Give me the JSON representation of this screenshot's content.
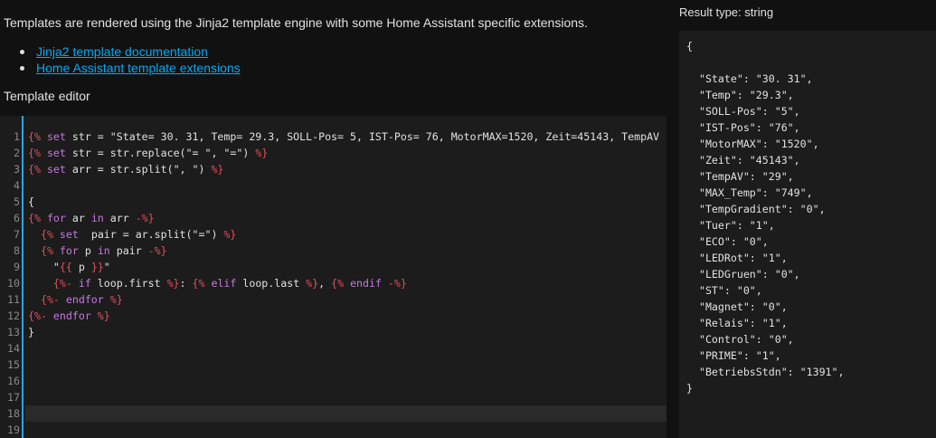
{
  "intro_text": "Templates are rendered using the Jinja2 template engine with some Home Assistant specific extensions.",
  "links": [
    "Jinja2 template documentation",
    "Home Assistant template extensions"
  ],
  "editor_label": "Template editor",
  "editor": {
    "lines": [
      {
        "n": "1",
        "segments": [
          {
            "t": "tag",
            "s": "{% "
          },
          {
            "t": "kw",
            "s": "set"
          },
          {
            "t": "str",
            "s": " str = \"State= 30. 31, Temp= 29.3, SOLL-Pos= 5, IST-Pos= 76, MotorMAX=1520, Zeit=45143, TempAV"
          }
        ]
      },
      {
        "n": "2",
        "segments": [
          {
            "t": "tag",
            "s": "{% "
          },
          {
            "t": "kw",
            "s": "set"
          },
          {
            "t": "str",
            "s": " str = str.replace(\"= \", \"=\") "
          },
          {
            "t": "tag",
            "s": "%}"
          }
        ]
      },
      {
        "n": "3",
        "segments": [
          {
            "t": "tag",
            "s": "{% "
          },
          {
            "t": "kw",
            "s": "set"
          },
          {
            "t": "str",
            "s": " arr = str.split(\", \") "
          },
          {
            "t": "tag",
            "s": "%}"
          }
        ]
      },
      {
        "n": "4",
        "segments": []
      },
      {
        "n": "5",
        "segments": [
          {
            "t": "str",
            "s": "{"
          }
        ]
      },
      {
        "n": "6",
        "segments": [
          {
            "t": "tag",
            "s": "{% "
          },
          {
            "t": "kw",
            "s": "for"
          },
          {
            "t": "str",
            "s": " ar "
          },
          {
            "t": "kw",
            "s": "in"
          },
          {
            "t": "str",
            "s": " arr "
          },
          {
            "t": "tag",
            "s": "-%}"
          }
        ]
      },
      {
        "n": "7",
        "segments": [
          {
            "t": "str",
            "s": "  "
          },
          {
            "t": "tag",
            "s": "{% "
          },
          {
            "t": "kw",
            "s": "set"
          },
          {
            "t": "str",
            "s": "  pair = ar.split(\"=\") "
          },
          {
            "t": "tag",
            "s": "%}"
          }
        ]
      },
      {
        "n": "8",
        "segments": [
          {
            "t": "str",
            "s": "  "
          },
          {
            "t": "tag",
            "s": "{% "
          },
          {
            "t": "kw",
            "s": "for"
          },
          {
            "t": "str",
            "s": " p "
          },
          {
            "t": "kw",
            "s": "in"
          },
          {
            "t": "str",
            "s": " pair "
          },
          {
            "t": "tag",
            "s": "-%}"
          }
        ]
      },
      {
        "n": "9",
        "segments": [
          {
            "t": "str",
            "s": "    \""
          },
          {
            "t": "tag",
            "s": "{{"
          },
          {
            "t": "str",
            "s": " p "
          },
          {
            "t": "tag",
            "s": "}}"
          },
          {
            "t": "str",
            "s": "\""
          }
        ]
      },
      {
        "n": "10",
        "segments": [
          {
            "t": "str",
            "s": "    "
          },
          {
            "t": "tag",
            "s": "{%- "
          },
          {
            "t": "kw",
            "s": "if"
          },
          {
            "t": "str",
            "s": " loop.first "
          },
          {
            "t": "tag",
            "s": "%}"
          },
          {
            "t": "str",
            "s": ": "
          },
          {
            "t": "tag",
            "s": "{% "
          },
          {
            "t": "kw",
            "s": "elif"
          },
          {
            "t": "str",
            "s": " loop.last "
          },
          {
            "t": "tag",
            "s": "%}"
          },
          {
            "t": "str",
            "s": ", "
          },
          {
            "t": "tag",
            "s": "{% "
          },
          {
            "t": "kw",
            "s": "endif"
          },
          {
            "t": "str",
            "s": " "
          },
          {
            "t": "tag",
            "s": "-%}"
          }
        ]
      },
      {
        "n": "11",
        "segments": [
          {
            "t": "str",
            "s": "  "
          },
          {
            "t": "tag",
            "s": "{%- "
          },
          {
            "t": "kw",
            "s": "endfor"
          },
          {
            "t": "str",
            "s": " "
          },
          {
            "t": "tag",
            "s": "%}"
          }
        ]
      },
      {
        "n": "12",
        "segments": [
          {
            "t": "tag",
            "s": "{%- "
          },
          {
            "t": "kw",
            "s": "endfor"
          },
          {
            "t": "str",
            "s": " "
          },
          {
            "t": "tag",
            "s": "%}"
          }
        ]
      },
      {
        "n": "13",
        "segments": [
          {
            "t": "str",
            "s": "}"
          }
        ]
      },
      {
        "n": "14",
        "segments": []
      },
      {
        "n": "15",
        "segments": []
      },
      {
        "n": "16",
        "segments": []
      },
      {
        "n": "17",
        "segments": []
      },
      {
        "n": "18",
        "segments": []
      },
      {
        "n": "19",
        "segments": []
      }
    ]
  },
  "result_type": "Result type: string",
  "result_lines": [
    "{",
    "",
    "  \"State\": \"30. 31\",",
    "  \"Temp\": \"29.3\",",
    "  \"SOLL-Pos\": \"5\",",
    "  \"IST-Pos\": \"76\",",
    "  \"MotorMAX\": \"1520\",",
    "  \"Zeit\": \"45143\",",
    "  \"TempAV\": \"29\",",
    "  \"MAX_Temp\": \"749\",",
    "  \"TempGradient\": \"0\",",
    "  \"Tuer\": \"1\",",
    "  \"ECO\": \"0\",",
    "  \"LEDRot\": \"1\",",
    "  \"LEDGruen\": \"0\",",
    "  \"ST\": \"0\",",
    "  \"Magnet\": \"0\",",
    "  \"Relais\": \"1\",",
    "  \"Control\": \"0\",",
    "  \"PRIME\": \"1\",",
    "  \"BetriebsStdn\": \"1391\",",
    "}"
  ]
}
